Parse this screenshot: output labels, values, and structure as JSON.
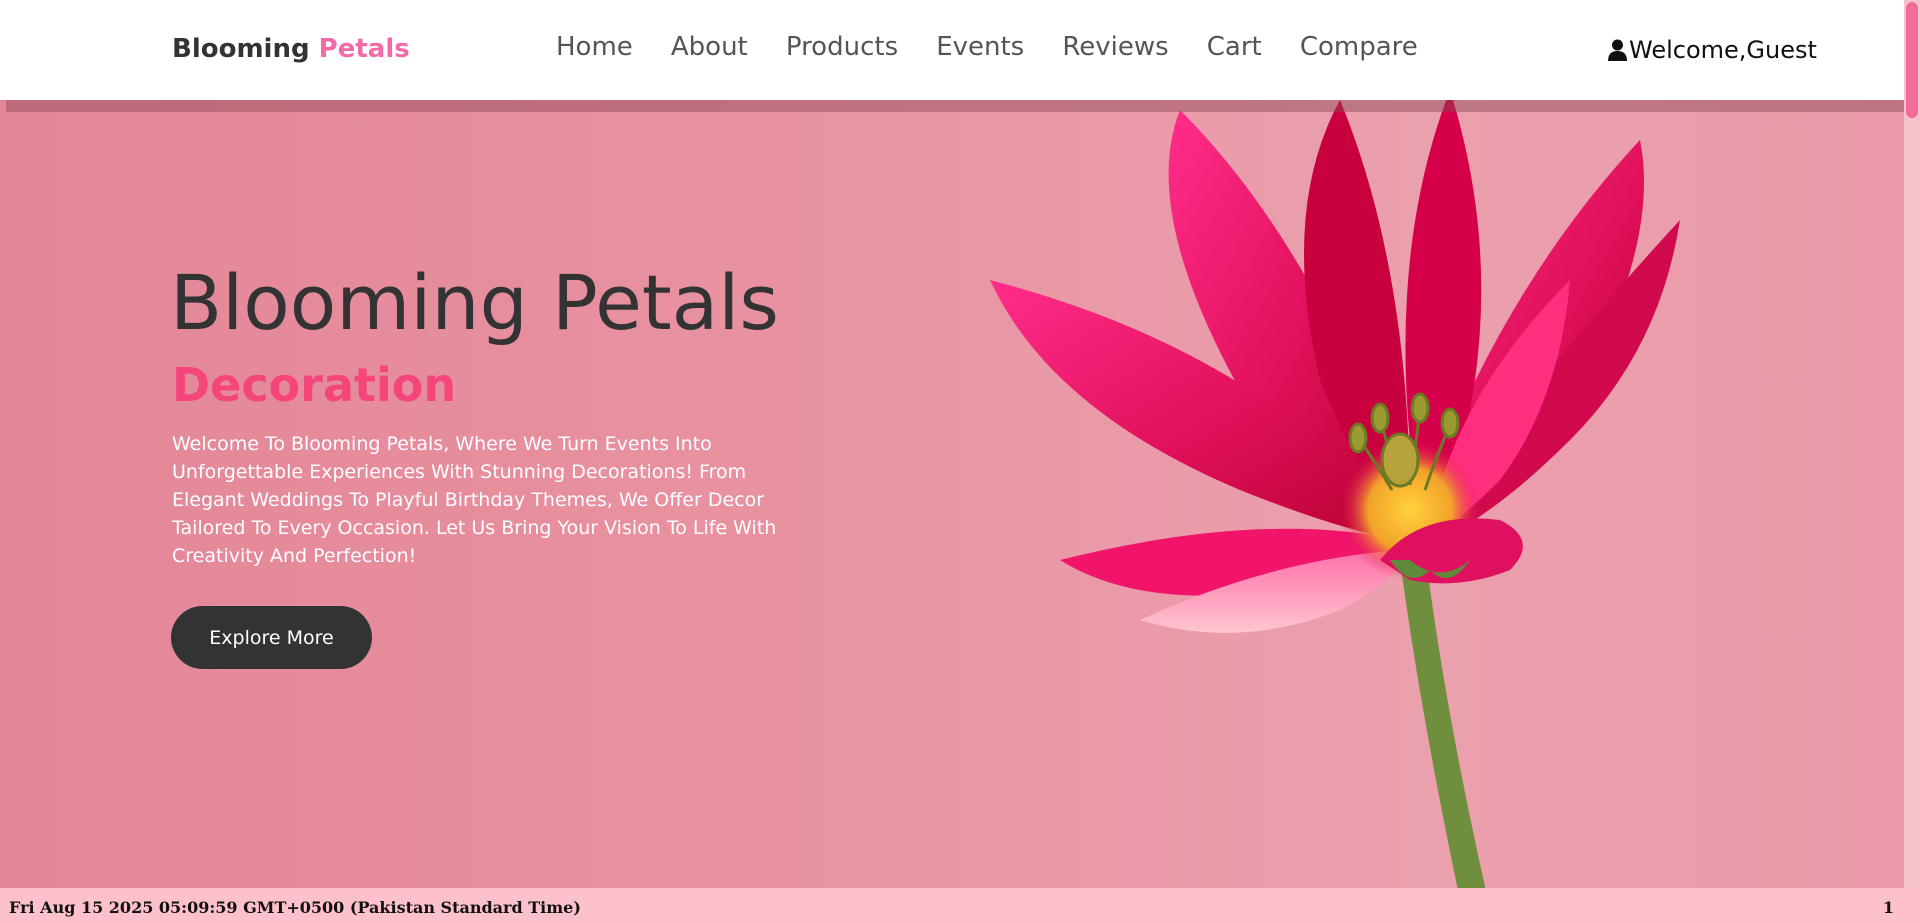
{
  "brand": {
    "name_part1": "Blooming",
    "name_part2": "Petals"
  },
  "nav": {
    "items": [
      {
        "label": "Home"
      },
      {
        "label": "About"
      },
      {
        "label": "Products"
      },
      {
        "label": "Events"
      },
      {
        "label": "Reviews"
      },
      {
        "label": "Cart"
      },
      {
        "label": "Compare"
      }
    ]
  },
  "user": {
    "icon": "user-icon",
    "greeting": "Welcome,Guest"
  },
  "hero": {
    "title": "Blooming Petals",
    "subtitle": "Decoration",
    "description": "Welcome To Blooming Petals, Where We Turn Events Into Unforgettable Experiences With Stunning Decorations! From Elegant Weddings To Playful Birthday Themes, We Offer Decor Tailored To Every Occasion. Let Us Bring Your Vision To Life With Creativity And Perfection!",
    "cta_label": "Explore More"
  },
  "footer": {
    "datetime": "Fri Aug 15 2025 05:09:59 GMT+0500 (Pakistan Standard Time)",
    "counter": "1"
  },
  "colors": {
    "brand_accent": "#f06ba8",
    "subtitle": "#f5467b",
    "hero_bg": "#e894a2",
    "button_bg": "#333333",
    "footer_bg": "#fcc1cb"
  }
}
